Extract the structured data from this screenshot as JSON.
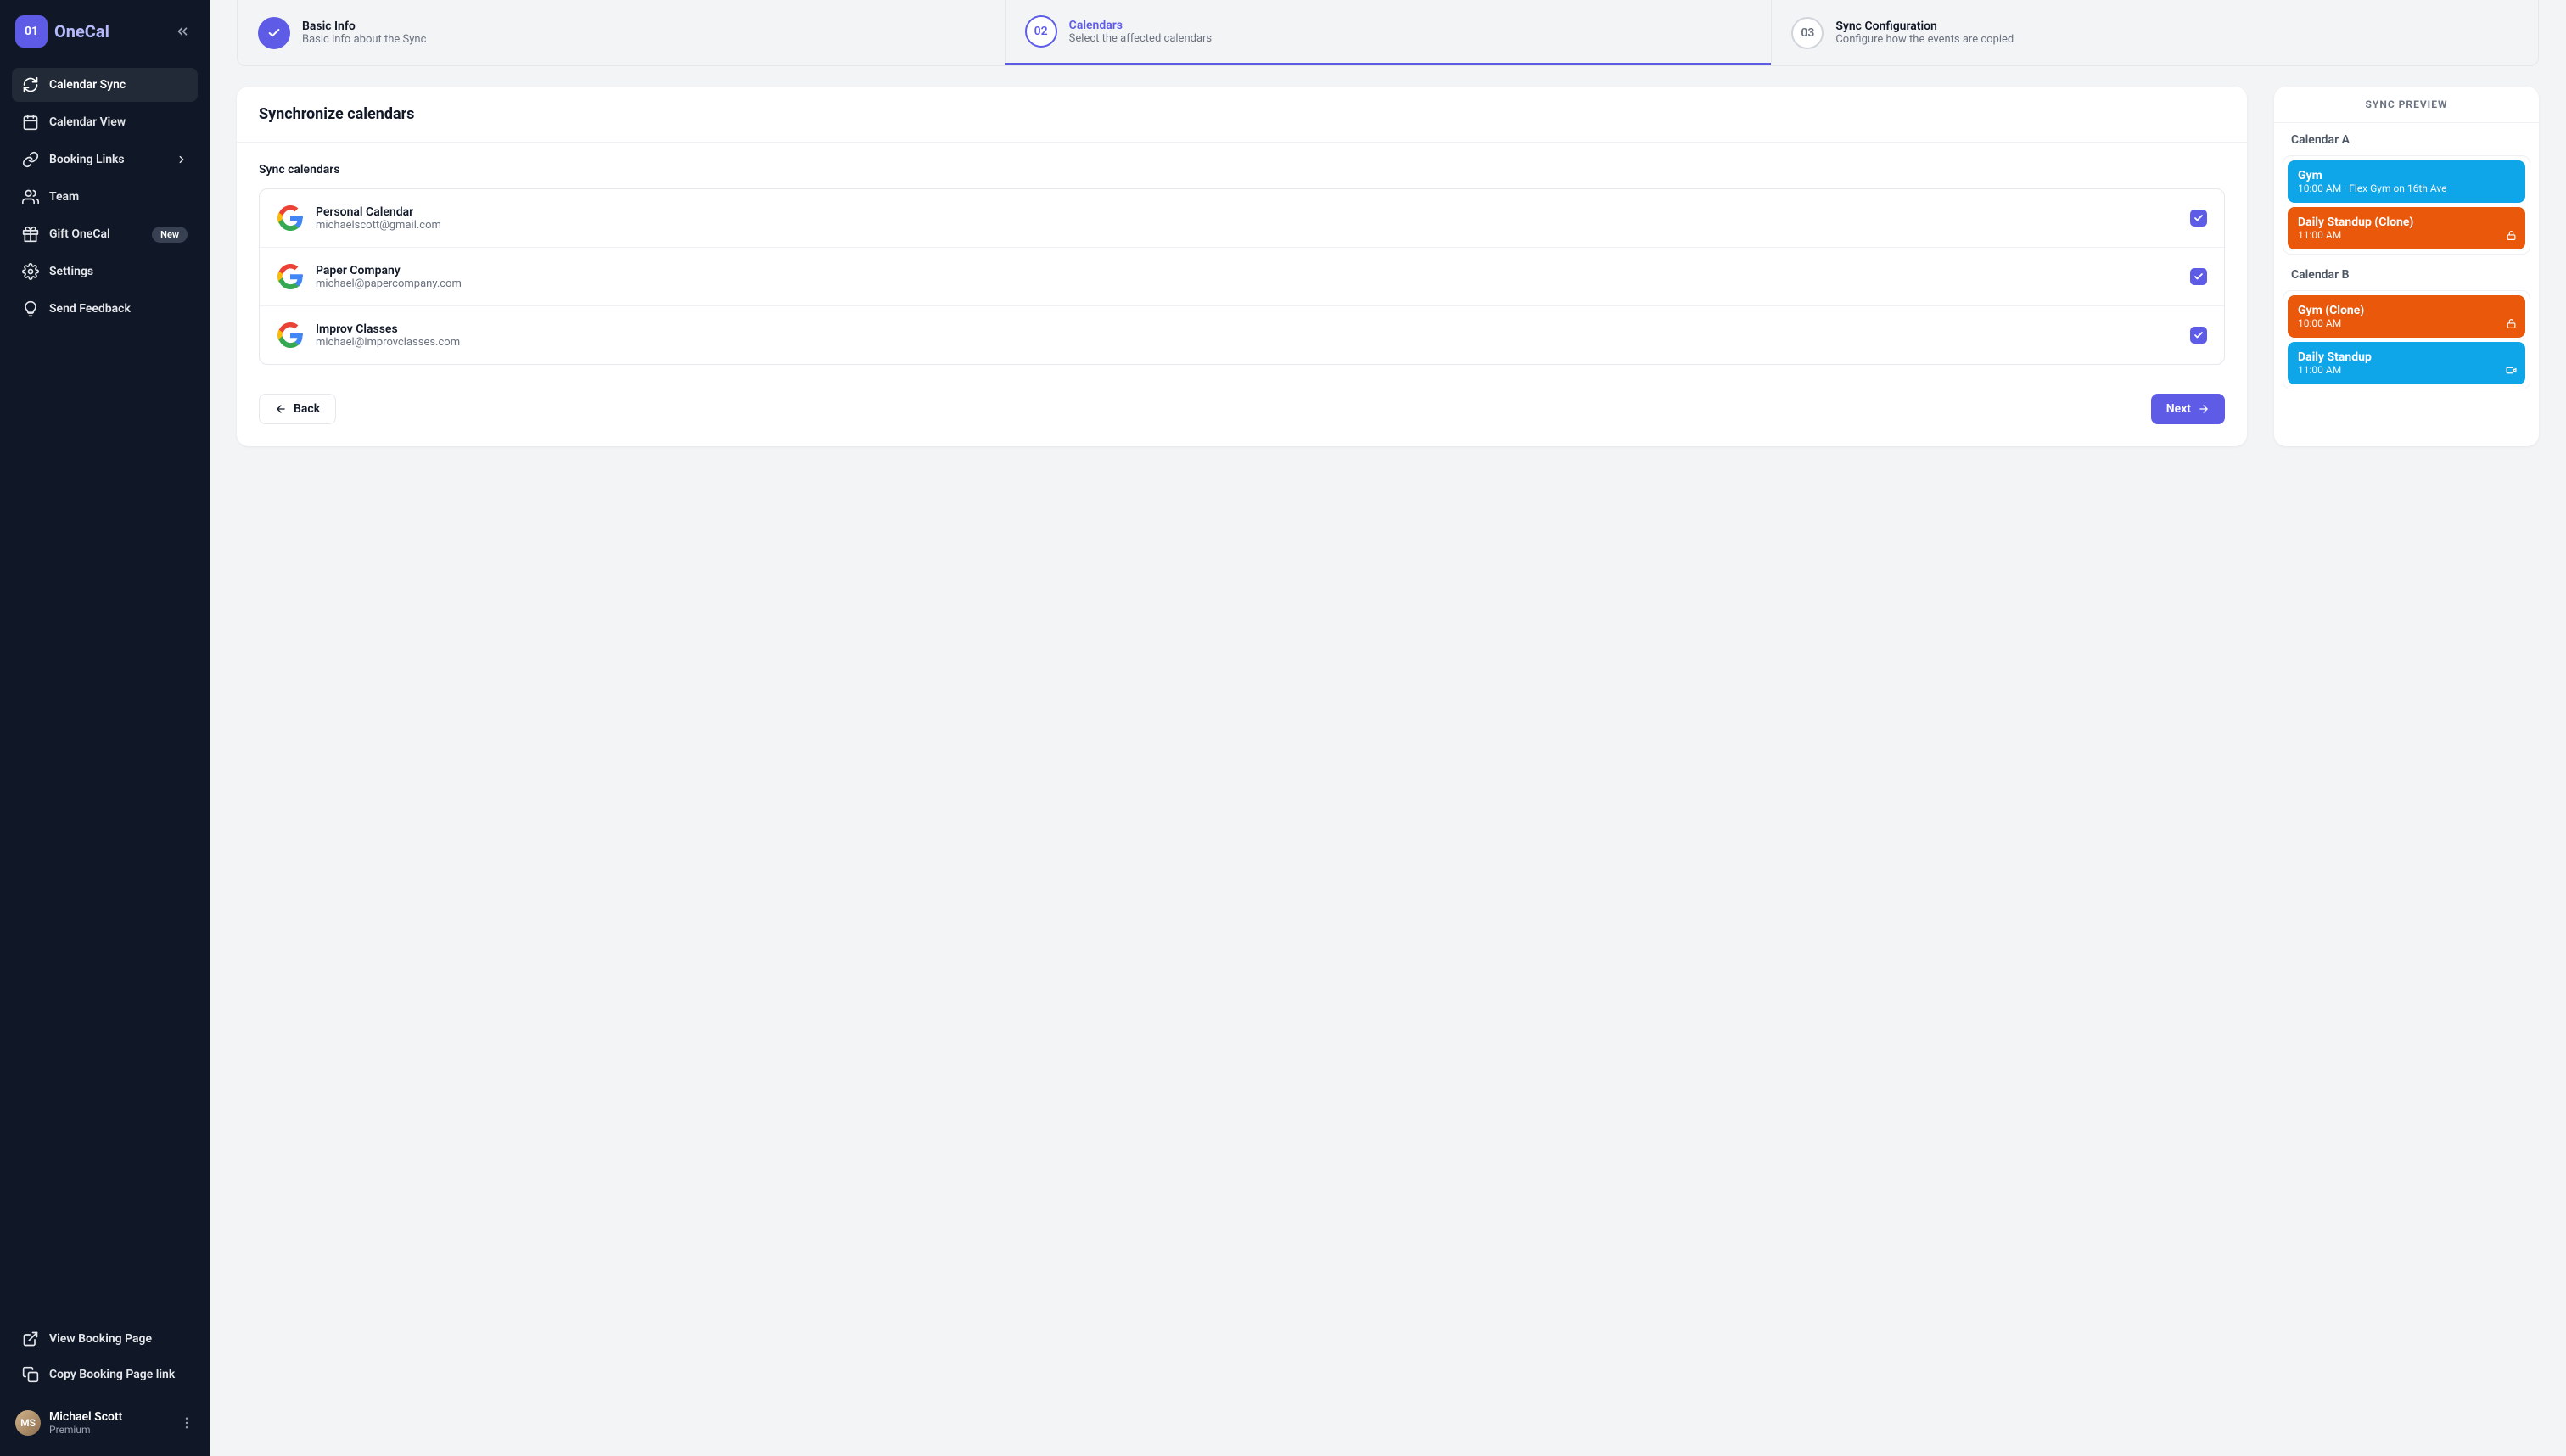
{
  "brand": {
    "mark": "01",
    "name": "OneCal"
  },
  "sidebar": {
    "items": [
      {
        "label": "Calendar Sync"
      },
      {
        "label": "Calendar View"
      },
      {
        "label": "Booking Links"
      },
      {
        "label": "Team"
      },
      {
        "label": "Gift OneCal",
        "badge": "New"
      },
      {
        "label": "Settings"
      },
      {
        "label": "Send Feedback"
      }
    ],
    "bottom": [
      {
        "label": "View Booking Page"
      },
      {
        "label": "Copy Booking Page link"
      }
    ]
  },
  "user": {
    "name": "Michael Scott",
    "plan": "Premium",
    "initials": "MS"
  },
  "steps": [
    {
      "num": "",
      "title": "Basic Info",
      "sub": "Basic info about the Sync"
    },
    {
      "num": "02",
      "title": "Calendars",
      "sub": "Select the affected calendars"
    },
    {
      "num": "03",
      "title": "Sync Configuration",
      "sub": "Configure how the events are copied"
    }
  ],
  "mainCard": {
    "header": "Synchronize calendars",
    "section": "Sync calendars",
    "calendars": [
      {
        "name": "Personal Calendar",
        "email": "michaelscott@gmail.com"
      },
      {
        "name": "Paper Company",
        "email": "michael@papercompany.com"
      },
      {
        "name": "Improv Classes",
        "email": "michael@improvclasses.com"
      }
    ],
    "back": "Back",
    "next": "Next"
  },
  "preview": {
    "header": "SYNC PREVIEW",
    "a": {
      "label": "Calendar A",
      "events": [
        {
          "title": "Gym",
          "sub": "10:00 AM · Flex Gym on 16th Ave",
          "color": "blue"
        },
        {
          "title": "Daily Standup (Clone)",
          "sub": "11:00 AM",
          "color": "orange",
          "icon": "lock"
        }
      ]
    },
    "b": {
      "label": "Calendar B",
      "events": [
        {
          "title": "Gym (Clone)",
          "sub": "10:00 AM",
          "color": "orange",
          "icon": "lock"
        },
        {
          "title": "Daily Standup",
          "sub": "11:00 AM",
          "color": "blue",
          "icon": "video"
        }
      ]
    }
  }
}
